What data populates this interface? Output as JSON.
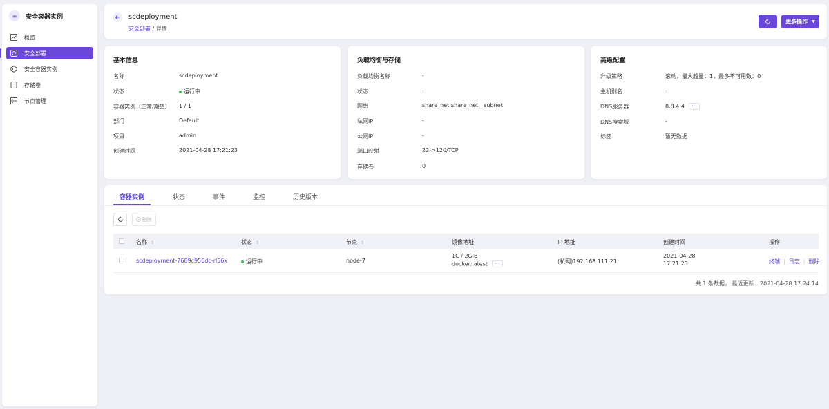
{
  "sidebar": {
    "title": "安全容器实例",
    "items": [
      {
        "label": "概览"
      },
      {
        "label": "安全部署"
      },
      {
        "label": "安全容器实例"
      },
      {
        "label": "存储卷"
      },
      {
        "label": "节点管理"
      }
    ]
  },
  "header": {
    "title": "scdeployment",
    "breadcrumb_link": "安全部署",
    "breadcrumb_sep": " / ",
    "breadcrumb_current": "详情",
    "more_label": "更多操作"
  },
  "basic": {
    "title": "基本信息",
    "rows": [
      {
        "key": "名称",
        "value": "scdeployment"
      },
      {
        "key": "状态",
        "value": "运行中"
      },
      {
        "key": "容器实例（正常/期望）",
        "value": "1 / 1"
      },
      {
        "key": "部门",
        "value": "Default"
      },
      {
        "key": "项目",
        "value": "admin"
      },
      {
        "key": "创建时间",
        "value": "2021-04-28 17:21:23"
      }
    ]
  },
  "lb": {
    "title": "负载均衡与存储",
    "rows": [
      {
        "key": "负载均衡名称",
        "value": "-"
      },
      {
        "key": "状态",
        "value": "-"
      },
      {
        "key": "网络",
        "value": "share_net:share_net__subnet"
      },
      {
        "key": "私网IP",
        "value": "-"
      },
      {
        "key": "公网IP",
        "value": "-"
      },
      {
        "key": "端口映射",
        "value": "22->120/TCP"
      },
      {
        "key": "存储卷",
        "value": "0"
      }
    ]
  },
  "advanced": {
    "title": "高级配置",
    "rows": [
      {
        "key": "升级策略",
        "value": "滚动，最大超量：1，最多不可用数：0"
      },
      {
        "key": "主机别名",
        "value": "-"
      },
      {
        "key": "DNS服务器",
        "value": "8.8.4.4"
      },
      {
        "key": "DNS搜索域",
        "value": "-"
      },
      {
        "key": "标签",
        "value": "暂无数据"
      }
    ]
  },
  "tabs": [
    {
      "label": "容器实例"
    },
    {
      "label": "状态"
    },
    {
      "label": "事件"
    },
    {
      "label": "监控"
    },
    {
      "label": "历史版本"
    }
  ],
  "toolbar": {
    "delete_label": "删除"
  },
  "table": {
    "headers": [
      "名称",
      "状态",
      "节点",
      "镜像地址",
      "IP 地址",
      "创建时间",
      "操作"
    ],
    "row": {
      "name": "scdeployment-7689c956dc-rl56x",
      "status": "运行中",
      "node": "node-7",
      "image_spec": "1C / 2GiB",
      "image": "docker:latest",
      "ip": "(私网)192.168.111.21",
      "created_date": "2021-04-28",
      "created_time": "17:21:23",
      "actions": [
        "终端",
        "日志",
        "删除"
      ]
    }
  },
  "footer": {
    "summary": "共 1 条数据， 最近更新",
    "updated": "2021-04-28 17:24:14"
  },
  "more_chip": "···",
  "colors": {
    "accent": "#6a47d8",
    "running": "#3bb34a",
    "link": "#5b45d6"
  }
}
